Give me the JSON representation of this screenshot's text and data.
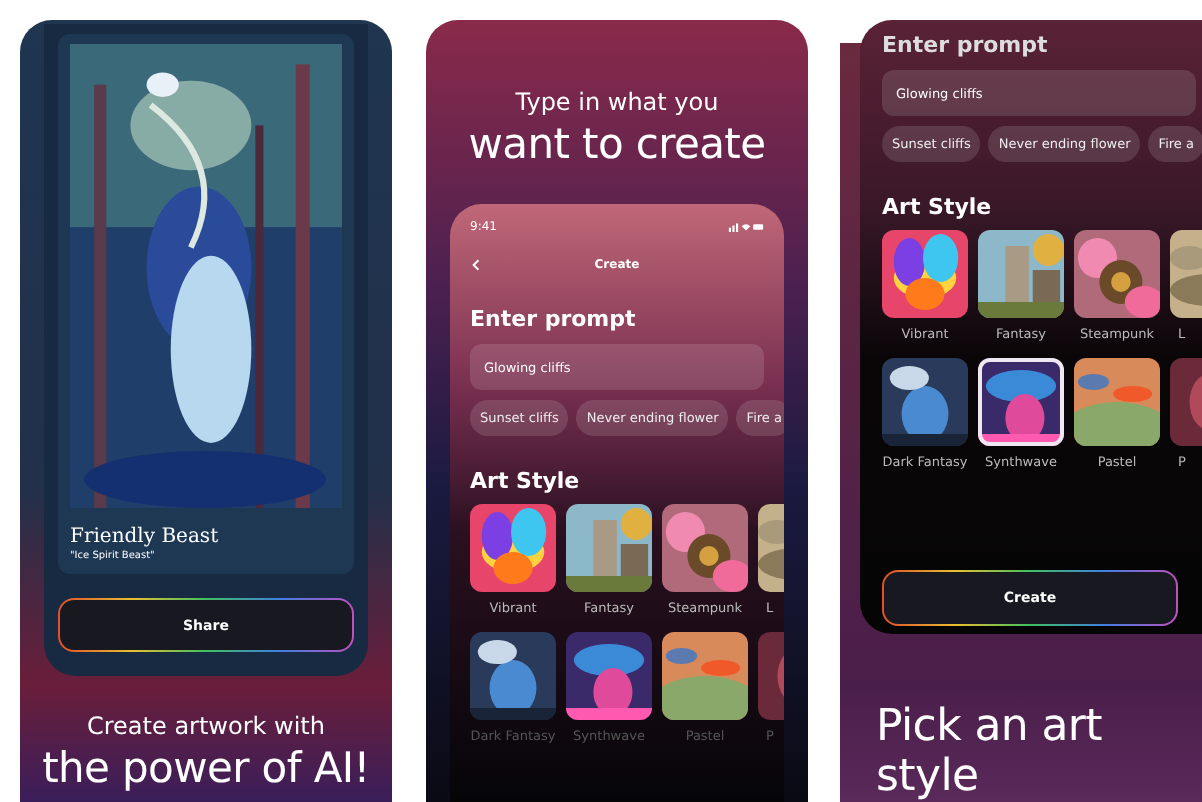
{
  "artwork_screen": {
    "art_title": "Friendly Beast",
    "art_subtitle": "\"Ice Spirit Beast\"",
    "button": "Share",
    "caption_small": "Create artwork with",
    "caption_large": "the power of AI!"
  },
  "create_screen": {
    "heading_small": "Type in what you",
    "heading_large": "want to create",
    "status_time": "9:41",
    "nav_title": "Create",
    "prompt_label": "Enter prompt",
    "prompt_value": "Glowing cliffs",
    "suggestions": [
      "Sunset cliffs",
      "Never ending flower",
      "Fire a"
    ],
    "style_label": "Art Style",
    "styles": [
      {
        "label": "Vibrant",
        "selected": false
      },
      {
        "label": "Fantasy",
        "selected": false
      },
      {
        "label": "Steampunk",
        "selected": false
      },
      {
        "label": "L",
        "selected": false
      },
      {
        "label": "Dark Fantasy",
        "selected": false
      },
      {
        "label": "Synthwave",
        "selected": false
      },
      {
        "label": "Pastel",
        "selected": false
      },
      {
        "label": "P",
        "selected": false
      }
    ]
  },
  "style_screen": {
    "prompt_label": "Enter prompt",
    "prompt_value": "Glowing cliffs",
    "suggestions": [
      "Sunset cliffs",
      "Never ending flower",
      "Fire a"
    ],
    "style_label": "Art Style",
    "styles": [
      {
        "label": "Vibrant",
        "selected": false
      },
      {
        "label": "Fantasy",
        "selected": false
      },
      {
        "label": "Steampunk",
        "selected": false
      },
      {
        "label": "L",
        "selected": false
      },
      {
        "label": "Dark Fantasy",
        "selected": false
      },
      {
        "label": "Synthwave",
        "selected": true
      },
      {
        "label": "Pastel",
        "selected": false
      },
      {
        "label": "P",
        "selected": false
      }
    ],
    "button": "Create",
    "caption_large": "Pick an art style"
  }
}
